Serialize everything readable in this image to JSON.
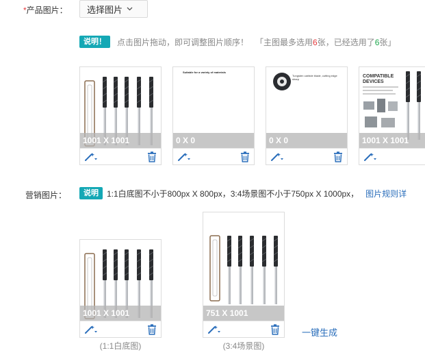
{
  "product_images": {
    "label_required_mark": "*",
    "label": "产品图片：",
    "select_button": "选择图片",
    "badge": "说明！",
    "tip_main": "点击图片拖动，即可调整图片顺序！",
    "tip_limit_prefix": "「主图最多选用",
    "tip_limit_max": "6",
    "tip_limit_mid": "张，已经选用了",
    "tip_limit_used": "6",
    "tip_limit_suffix": "张」",
    "cards": [
      {
        "dimension": "1001 X 1001"
      },
      {
        "dimension": "0 X 0",
        "thumb_title": "Suitable for a variety of materials"
      },
      {
        "dimension": "0 X 0",
        "thumb_title": "Tungsten carbide blade, cutting edge sharp"
      },
      {
        "dimension": "1001 X 1001",
        "thumb_title": "COMPATIBLE DEVICES"
      }
    ]
  },
  "marketing_images": {
    "label": "营销图片：",
    "badge": "说明",
    "tip": "1:1白底图不小于800px X 800px，3:4场景图不小于750px X 1000px，",
    "rules_link": "图片规则详",
    "cards": [
      {
        "dimension": "1001 X 1001",
        "caption": "(1:1白底图)"
      },
      {
        "dimension": "751 X 1001",
        "caption": "(3:4场景图)"
      }
    ],
    "generate_link": "一键生成"
  },
  "colors": {
    "badge_bg": "#14a8b5",
    "link": "#2a6ebb",
    "required": "#e4393c",
    "used_count": "#1fa84e"
  }
}
